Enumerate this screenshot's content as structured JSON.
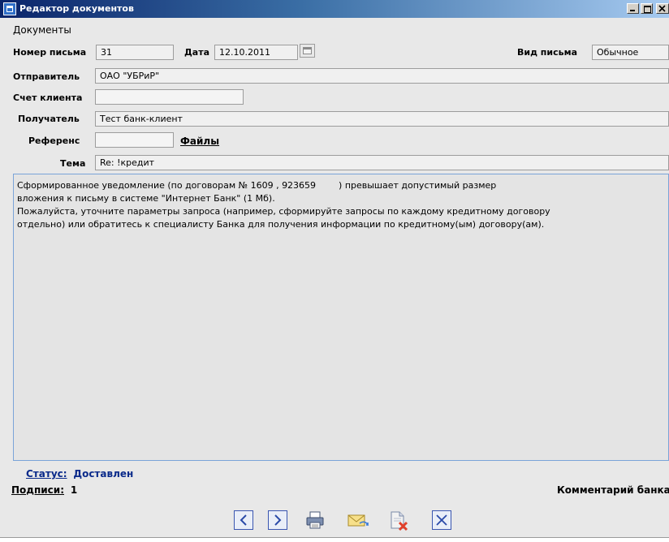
{
  "window": {
    "title": "Редактор документов"
  },
  "menu": {
    "documents": "Документы"
  },
  "form": {
    "letter_number_label": "Номер письма",
    "letter_number_value": "31",
    "date_label": "Дата",
    "date_value": "12.10.2011",
    "letter_type_label": "Вид письма",
    "letter_type_value": "Обычное",
    "sender_label": "Отправитель",
    "sender_value": "ОАО \"УБРиР\"",
    "client_account_label": "Счет клиента",
    "client_account_value": "",
    "recipient_label": "Получатель",
    "recipient_value": "Тест банк-клиент",
    "reference_label": "Референс",
    "reference_value": "",
    "files_link": "Файлы",
    "subject_label": "Тема",
    "subject_value": "Re: !кредит"
  },
  "message_body": "Сформированное уведомление (по договорам № 1609 , 923659        ) превышает допустимый размер\nвложения к письму в системе \"Интернет Банк\" (1 Мб).\nПожалуйста, уточните параметры запроса (например, сформируйте запросы по каждому кредитному договору\nотдельно) или обратитесь к специалисту Банка для получения информации по кредитному(ым) договору(ам).",
  "footer": {
    "status_label": "Статус:",
    "status_value": "Доставлен",
    "signatures_label": "Подписи:",
    "signatures_value": "1",
    "bank_comment_label": "Комментарий банка"
  },
  "toolbar_icons": [
    "prev-icon",
    "next-icon",
    "print-icon",
    "send-envelope-icon",
    "delete-document-icon",
    "close-icon"
  ],
  "colors": {
    "accent_blue": "#0a2a8a",
    "title_bar": "#0a246a",
    "body_border": "#7aa4d8"
  }
}
